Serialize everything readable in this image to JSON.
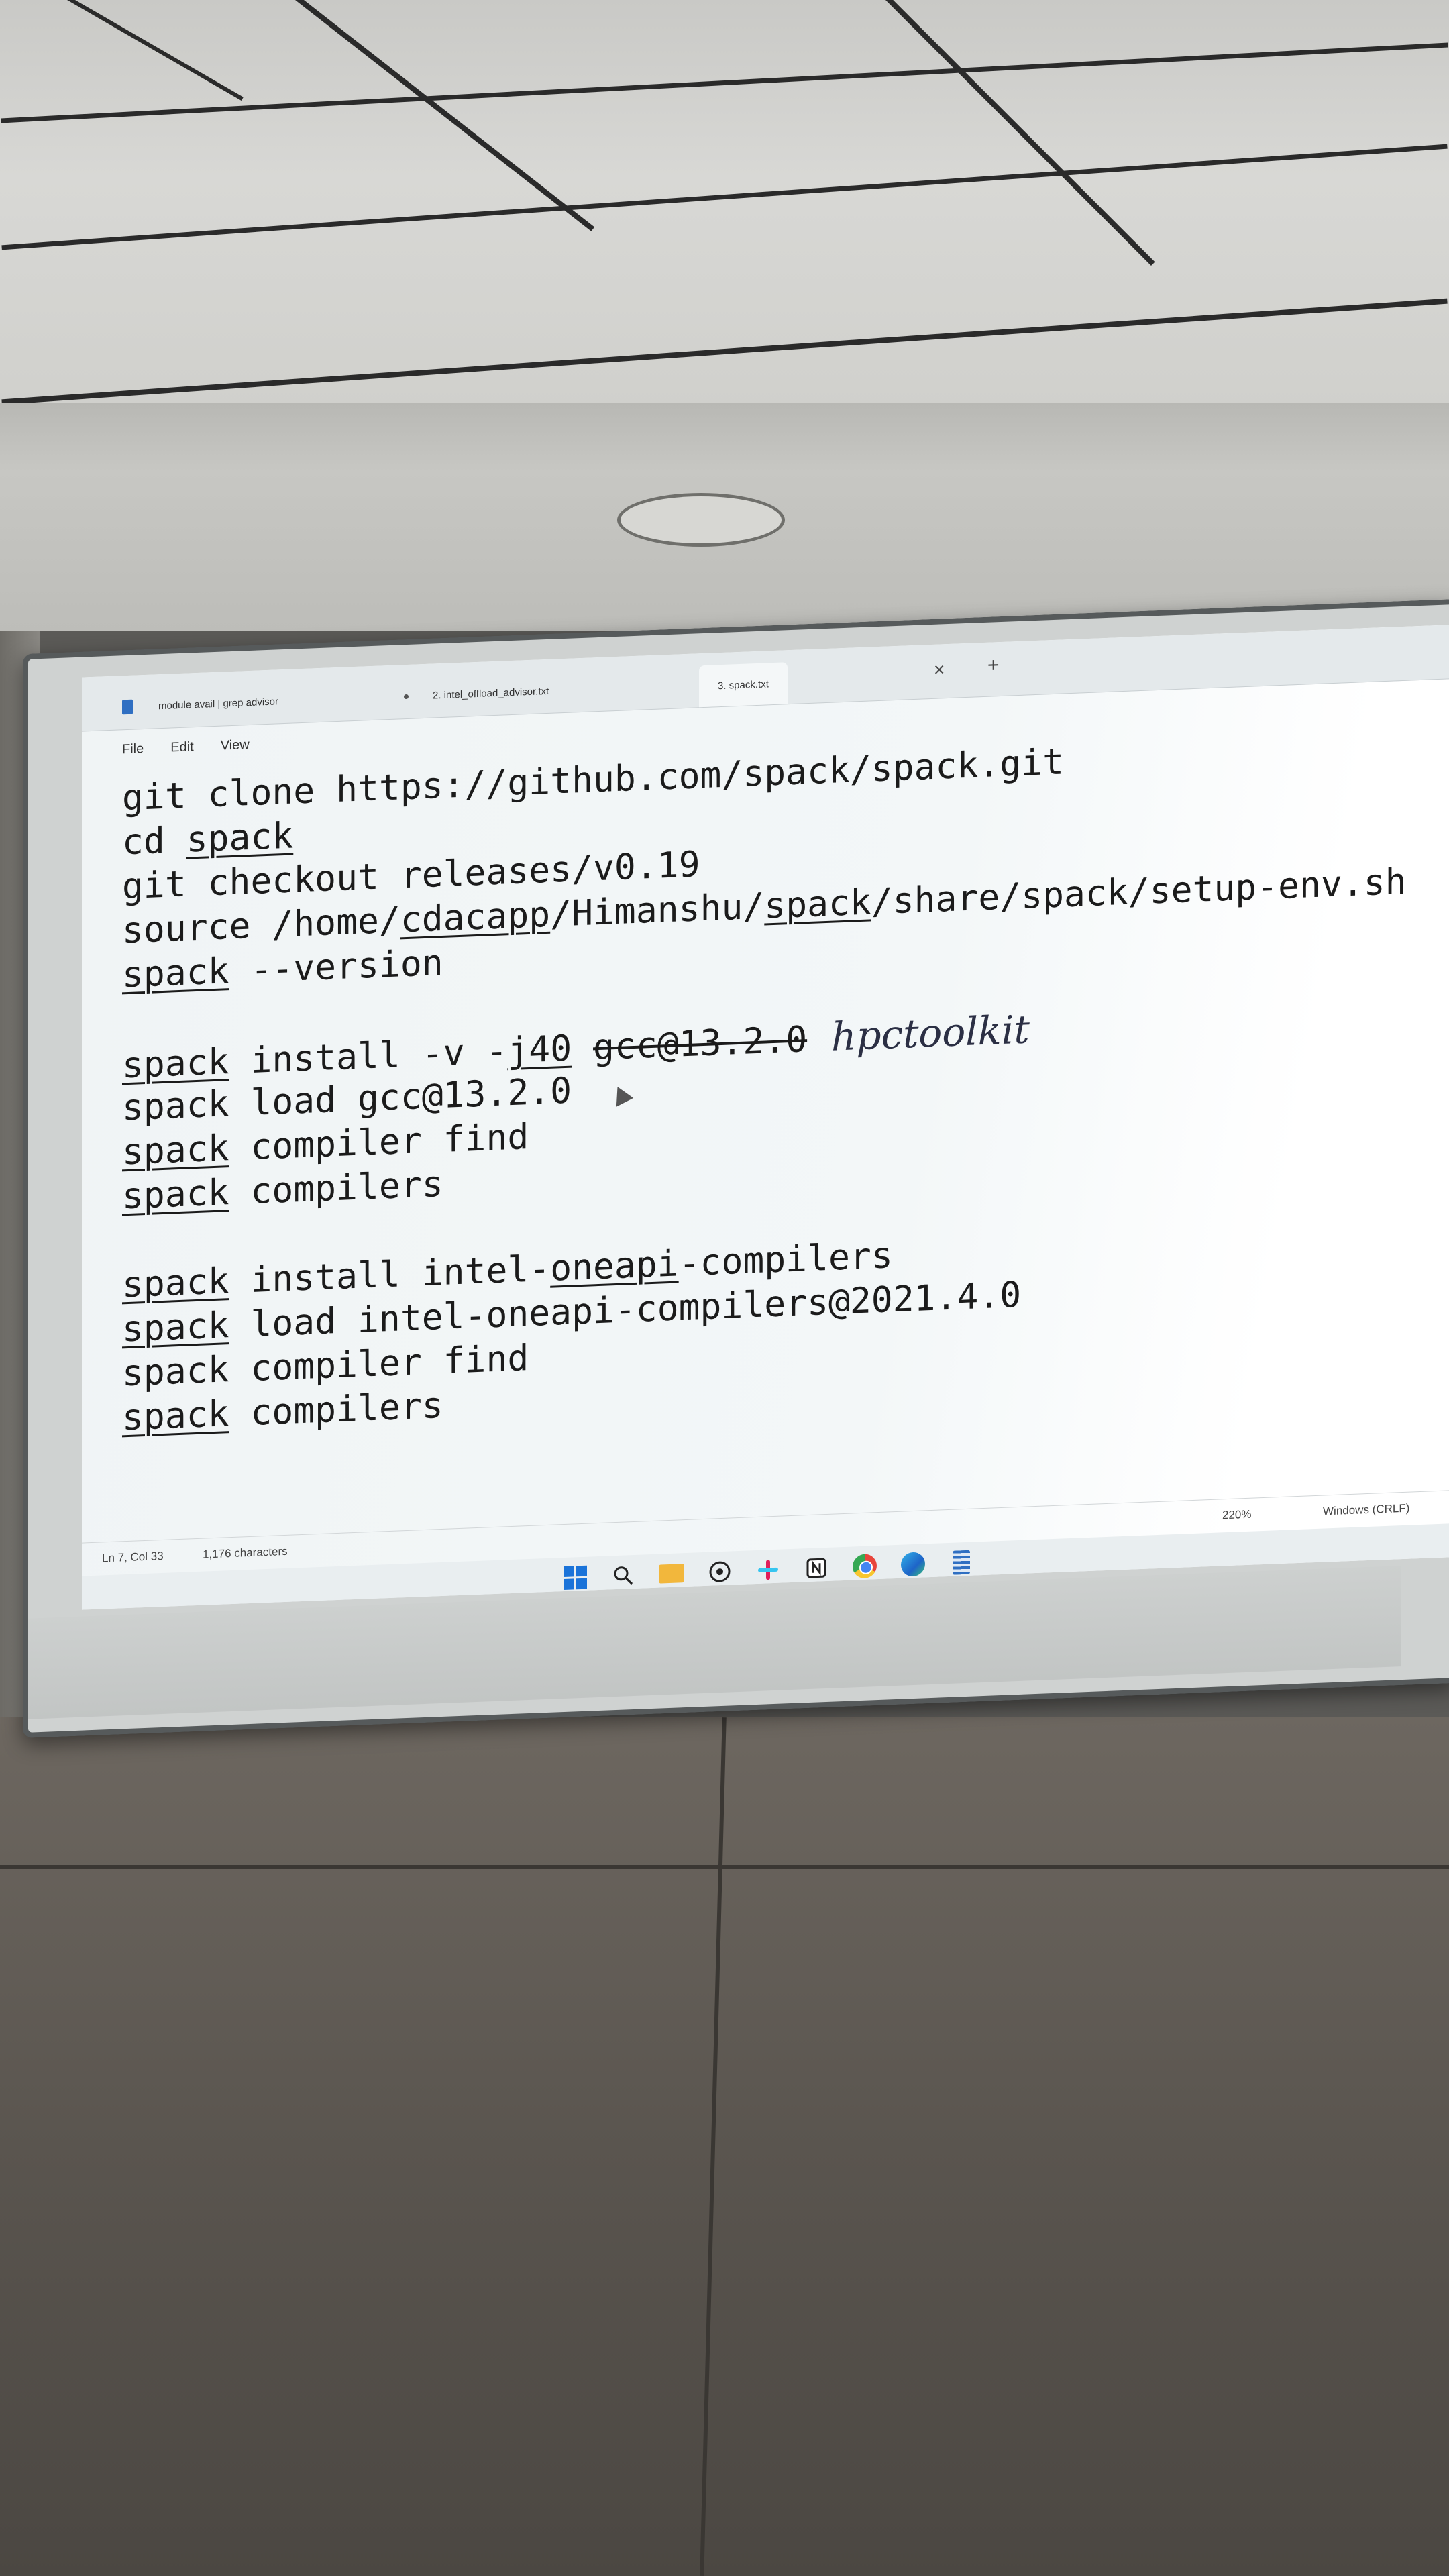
{
  "tabs": [
    {
      "label": "module avail | grep advisor",
      "active": false
    },
    {
      "label": "2. intel_offload_advisor.txt",
      "active": false
    },
    {
      "label": "3. spack.txt",
      "active": true
    }
  ],
  "tab_close_icon": "×",
  "tab_add_icon": "+",
  "menu": {
    "file": "File",
    "edit": "Edit",
    "view": "View"
  },
  "code": {
    "l1": "git clone https://github.com/spack/spack.git",
    "l2_a": "cd ",
    "l2_b": "spack",
    "l3": "git checkout releases/v0.19",
    "l4_a": "source /home/",
    "l4_b": "cdacapp",
    "l4_c": "/Himanshu/",
    "l4_d": "spack",
    "l4_e": "/share/spack/setup-env.sh",
    "l5_a": "spack",
    "l5_b": " --version",
    "l6_a": "spack",
    "l6_b": " install -v -",
    "l6_c": "j40",
    "l6_d": " ",
    "l6_e": "gcc@13.2.0",
    "l6_hand": "hpctoolkit",
    "l7": "spack load gcc@13.2.0",
    "l8_a": "spack",
    "l8_b": " compiler find",
    "l9_a": "spack",
    "l9_b": " compilers",
    "l10_a": "spack",
    "l10_b": " install intel-",
    "l10_c": "oneapi",
    "l10_d": "-compilers",
    "l11_a": "spack",
    "l11_b": " load intel-oneapi-compilers@2021.4.0",
    "l12": "spack compiler find",
    "l13_a": "spack",
    "l13_b": " compilers"
  },
  "status": {
    "position": "Ln 7, Col 33",
    "chars": "1,176 characters",
    "zoom": "220%",
    "eol": "Windows (CRLF)"
  },
  "taskbar_icons": [
    "windows-start-icon",
    "search-icon",
    "file-explorer-icon",
    "whatsapp-icon",
    "slack-icon",
    "notion-icon",
    "chrome-icon",
    "edge-icon",
    "notepad-icon"
  ]
}
